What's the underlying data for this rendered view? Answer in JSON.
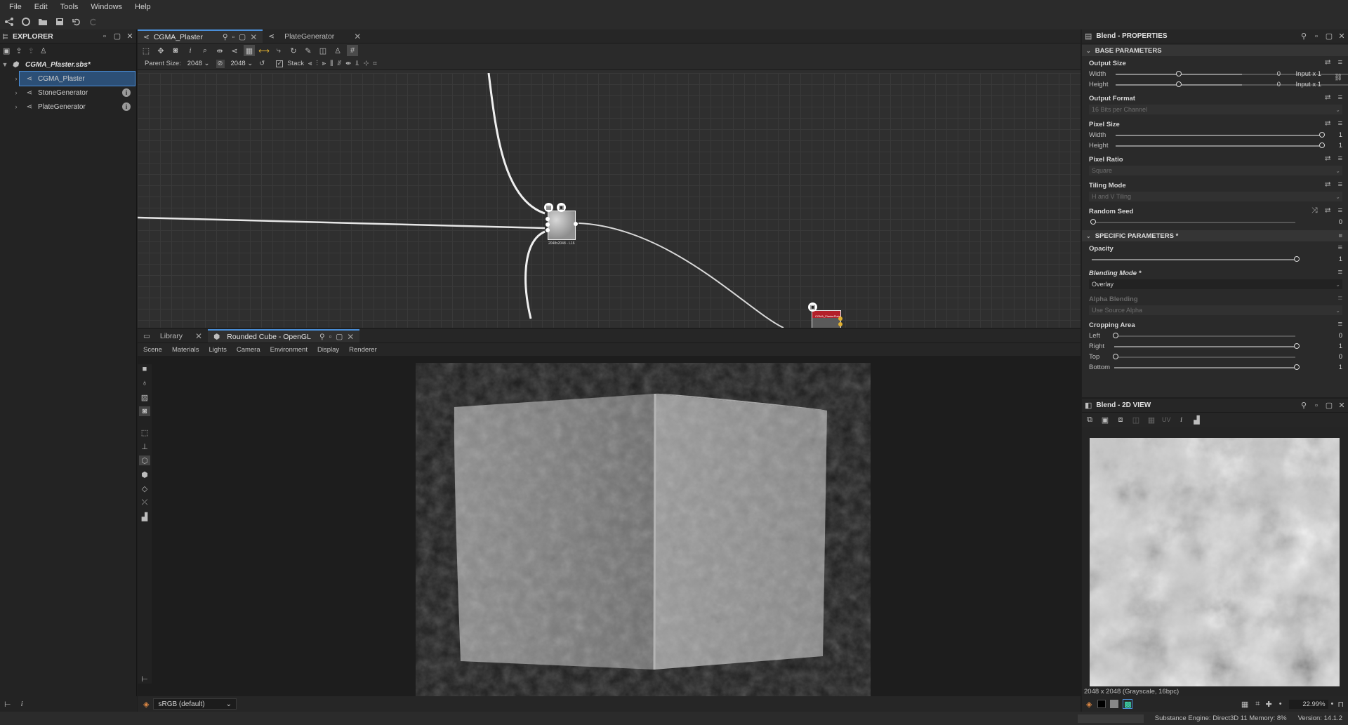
{
  "menu": [
    "File",
    "Edit",
    "Tools",
    "Windows",
    "Help"
  ],
  "explorer": {
    "title": "EXPLORER",
    "package": "CGMA_Plaster.sbs*",
    "items": [
      {
        "label": "CGMA_Plaster"
      },
      {
        "label": "StoneGenerator"
      },
      {
        "label": "PlateGenerator"
      }
    ]
  },
  "graph": {
    "tabs": [
      {
        "label": "CGMA_Plaster"
      },
      {
        "label": "PlateGenerator"
      }
    ],
    "parent_size_label": "Parent Size:",
    "parent_size_w": "2048",
    "parent_size_h": "2048",
    "stack_label": "Stack",
    "node_caption": "2048x2048 - L16",
    "output_node_title": "CGMA_PlasterPlate"
  },
  "view3d": {
    "tabs": [
      {
        "label": "Library"
      },
      {
        "label": "Rounded Cube - OpenGL"
      }
    ],
    "menu": [
      "Scene",
      "Materials",
      "Lights",
      "Camera",
      "Environment",
      "Display",
      "Renderer"
    ],
    "colorspace": "sRGB (default)"
  },
  "properties": {
    "title": "Blend - PROPERTIES",
    "base_section": "BASE PARAMETERS",
    "specific_section": "SPECIFIC PARAMETERS *",
    "output_size": {
      "label": "Output Size",
      "width_label": "Width",
      "height_label": "Height",
      "width_val": "0",
      "height_val": "0",
      "width_mode": "Input x 1",
      "height_mode": "Input x 1"
    },
    "output_format": {
      "label": "Output Format",
      "value": "16 Bits per Channel"
    },
    "pixel_size": {
      "label": "Pixel Size",
      "width_label": "Width",
      "height_label": "Height",
      "width_val": "1",
      "height_val": "1"
    },
    "pixel_ratio": {
      "label": "Pixel Ratio",
      "value": "Square"
    },
    "tiling_mode": {
      "label": "Tiling Mode",
      "value": "H and V Tiling"
    },
    "random_seed": {
      "label": "Random Seed",
      "value": "0"
    },
    "opacity": {
      "label": "Opacity",
      "value": "1"
    },
    "blending_mode": {
      "label": "Blending Mode *",
      "value": "Overlay"
    },
    "alpha_blending": {
      "label": "Alpha Blending",
      "value": "Use Source Alpha"
    },
    "cropping": {
      "label": "Cropping Area",
      "left_label": "Left",
      "right_label": "Right",
      "top_label": "Top",
      "bottom_label": "Bottom",
      "left": "0",
      "right": "1",
      "top": "0",
      "bottom": "1"
    }
  },
  "view2d": {
    "title": "Blend - 2D VIEW",
    "uv_label": "UV",
    "resolution": "2048 x 2048 (Grayscale, 16bpc)",
    "zoom": "22.99%"
  },
  "status": {
    "engine": "Substance Engine: Direct3D 11  Memory: 8%",
    "version": "Version: 14.1.2"
  },
  "colors": {
    "accent": "#4a8ed8",
    "selection": "#2c4f76",
    "output_node": "#b3202a"
  }
}
